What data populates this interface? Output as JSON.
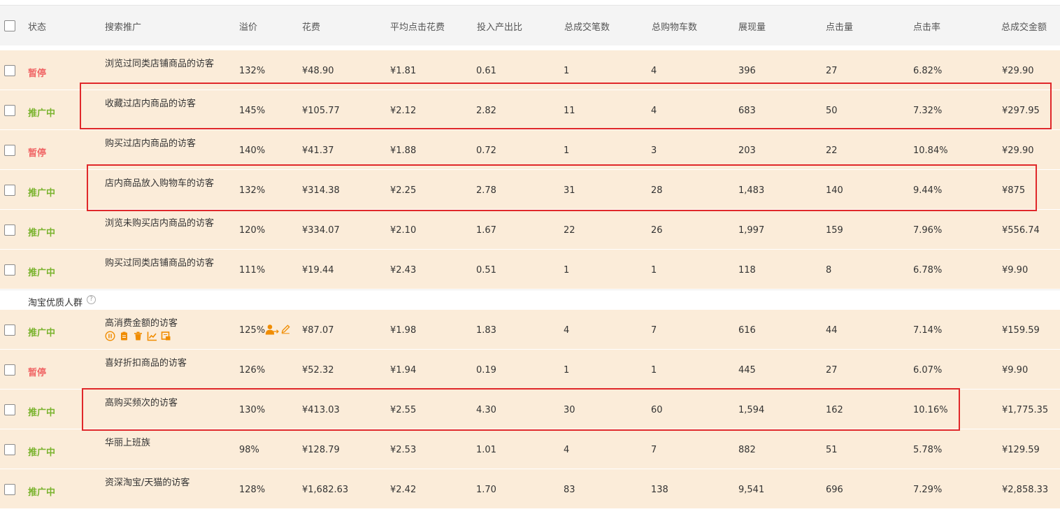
{
  "columns": [
    "状态",
    "搜索推广",
    "溢价",
    "花费",
    "平均点击花费",
    "投入产出比",
    "总成交笔数",
    "总购物车数",
    "展现量",
    "点击量",
    "点击率",
    "总成交金额"
  ],
  "group_label": "淘宝优质人群",
  "colors": {
    "paused": "#f06666",
    "active": "#7ab32e",
    "row_bg": "#fbecd9",
    "highlight": "#e0282a",
    "icon": "#f08c00"
  },
  "rows": [
    {
      "status": "暂停",
      "name": "浏览过同类店铺商品的访客",
      "premium": "132%",
      "cost": "¥48.90",
      "cpc": "¥1.81",
      "roi": "0.61",
      "orders": "1",
      "carts": "4",
      "impressions": "396",
      "clicks": "27",
      "ctr": "6.82%",
      "gmv": "¥29.90"
    },
    {
      "status": "推广中",
      "name": "收藏过店内商品的访客",
      "premium": "145%",
      "cost": "¥105.77",
      "cpc": "¥2.12",
      "roi": "2.82",
      "orders": "11",
      "carts": "4",
      "impressions": "683",
      "clicks": "50",
      "ctr": "7.32%",
      "gmv": "¥297.95"
    },
    {
      "status": "暂停",
      "name": "购买过店内商品的访客",
      "premium": "140%",
      "cost": "¥41.37",
      "cpc": "¥1.88",
      "roi": "0.72",
      "orders": "1",
      "carts": "3",
      "impressions": "203",
      "clicks": "22",
      "ctr": "10.84%",
      "gmv": "¥29.90"
    },
    {
      "status": "推广中",
      "name": "店内商品放入购物车的访客",
      "premium": "132%",
      "cost": "¥314.38",
      "cpc": "¥2.25",
      "roi": "2.78",
      "orders": "31",
      "carts": "28",
      "impressions": "1,483",
      "clicks": "140",
      "ctr": "9.44%",
      "gmv": "¥875"
    },
    {
      "status": "推广中",
      "name": "浏览未购买店内商品的访客",
      "premium": "120%",
      "cost": "¥334.07",
      "cpc": "¥2.10",
      "roi": "1.67",
      "orders": "22",
      "carts": "26",
      "impressions": "1,997",
      "clicks": "159",
      "ctr": "7.96%",
      "gmv": "¥556.74"
    },
    {
      "status": "推广中",
      "name": "购买过同类店铺商品的访客",
      "premium": "111%",
      "cost": "¥19.44",
      "cpc": "¥2.43",
      "roi": "0.51",
      "orders": "1",
      "carts": "1",
      "impressions": "118",
      "clicks": "8",
      "ctr": "6.78%",
      "gmv": "¥9.90"
    },
    {
      "status": "推广中",
      "name": "高消费金额的访客",
      "premium": "125%",
      "cost": "¥87.07",
      "cpc": "¥1.98",
      "roi": "1.83",
      "orders": "4",
      "carts": "7",
      "impressions": "616",
      "clicks": "44",
      "ctr": "7.14%",
      "gmv": "¥159.59"
    },
    {
      "status": "暂停",
      "name": "喜好折扣商品的访客",
      "premium": "126%",
      "cost": "¥52.32",
      "cpc": "¥1.94",
      "roi": "0.19",
      "orders": "1",
      "carts": "1",
      "impressions": "445",
      "clicks": "27",
      "ctr": "6.07%",
      "gmv": "¥9.90"
    },
    {
      "status": "推广中",
      "name": "高购买频次的访客",
      "premium": "130%",
      "cost": "¥413.03",
      "cpc": "¥2.55",
      "roi": "4.30",
      "orders": "30",
      "carts": "60",
      "impressions": "1,594",
      "clicks": "162",
      "ctr": "10.16%",
      "gmv": "¥1,775.35"
    },
    {
      "status": "推广中",
      "name": "华丽上班族",
      "premium": "98%",
      "cost": "¥128.79",
      "cpc": "¥2.53",
      "roi": "1.01",
      "orders": "4",
      "carts": "7",
      "impressions": "882",
      "clicks": "51",
      "ctr": "5.78%",
      "gmv": "¥129.59"
    },
    {
      "status": "推广中",
      "name": "资深淘宝/天猫的访客",
      "premium": "128%",
      "cost": "¥1,682.63",
      "cpc": "¥2.42",
      "roi": "1.70",
      "orders": "83",
      "carts": "138",
      "impressions": "9,541",
      "clicks": "696",
      "ctr": "7.29%",
      "gmv": "¥2,858.33"
    }
  ]
}
